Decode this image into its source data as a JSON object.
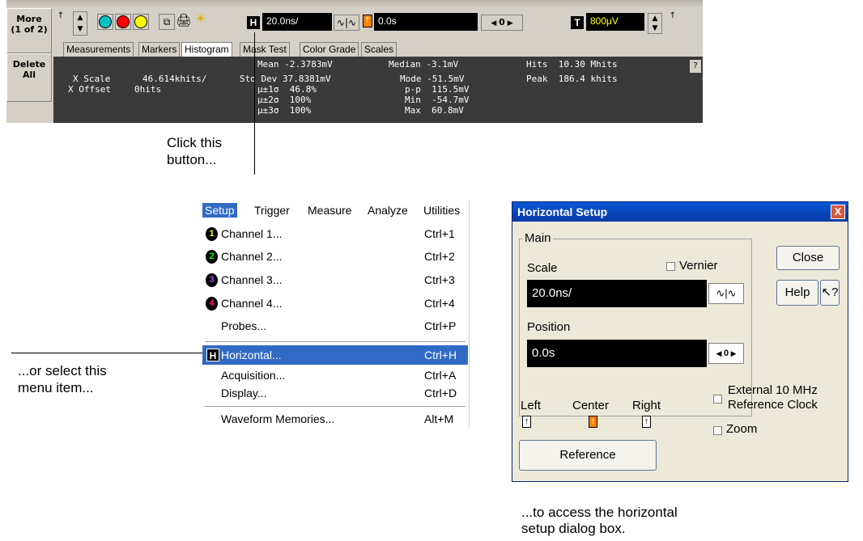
{
  "toolbar": {
    "more_label": "More",
    "more_sub": "(1 of 2)",
    "delete_label": "Delete",
    "delete_sub": "All",
    "h_badge": "H",
    "scale_value": "20.0ns/",
    "position_value": "0.0s",
    "zero_label": "0",
    "trigger_badge": "T",
    "trigger_level": "800μV",
    "tabs": [
      "Measurements",
      "Markers",
      "Histogram",
      "Mask Test",
      "Color Grade",
      "Scales"
    ],
    "stats_left": {
      "x_scale_label": "X Scale",
      "x_scale_value": "46.614khits/",
      "x_offset_label": "X Offset",
      "x_offset_value": "0hits"
    },
    "stats_col1": [
      "Mean -2.3783mV",
      "Std Dev 37.8381mV",
      "μ±1σ  46.8%",
      "μ±2σ  100%",
      "μ±3σ  100%"
    ],
    "stats_col2": [
      "Median -3.1mV",
      "Mode -51.5mV",
      "p-p  115.5mV",
      "Min  -54.7mV",
      "Max  60.8mV"
    ],
    "stats_col3": [
      "Hits  10.30 Mhits",
      "Peak  186.4 khits"
    ],
    "help_q": "?"
  },
  "callouts": {
    "click_button_line1": "Click this",
    "click_button_line2": "button...",
    "select_menu_line1": "...or select this",
    "select_menu_line2": "menu item...",
    "access_line1": "...to access the horizontal",
    "access_line2": "setup dialog box."
  },
  "menu": {
    "bar": [
      "Setup",
      "Trigger",
      "Measure",
      "Analyze",
      "Utilities"
    ],
    "items": [
      {
        "num": "1",
        "label": "Channel 1...",
        "shortcut": "Ctrl+1",
        "color": "#ffff00"
      },
      {
        "num": "2",
        "label": "Channel 2...",
        "shortcut": "Ctrl+2",
        "color": "#00ff00"
      },
      {
        "num": "3",
        "label": "Channel 3...",
        "shortcut": "Ctrl+3",
        "color": "#c040ff"
      },
      {
        "num": "4",
        "label": "Channel 4...",
        "shortcut": "Ctrl+4",
        "color": "#ff2080"
      },
      {
        "label": "Probes...",
        "shortcut": "Ctrl+P"
      },
      {
        "badge": "H",
        "label": "Horizontal...",
        "shortcut": "Ctrl+H"
      },
      {
        "label": "Acquisition...",
        "shortcut": "Ctrl+A"
      },
      {
        "label": "Display...",
        "shortcut": "Ctrl+D"
      },
      {
        "label": "Waveform Memories...",
        "shortcut": "Alt+M"
      }
    ]
  },
  "dialog": {
    "title": "Horizontal Setup",
    "close_x": "X",
    "main_group": "Main",
    "scale_label": "Scale",
    "vernier_label": "Vernier",
    "scale_value": "20.0ns/",
    "position_label": "Position",
    "position_value": "0.0s",
    "zero_label": "0",
    "close_button": "Close",
    "help_button": "Help",
    "whats_this": "?",
    "external_ref_line1": "External 10 MHz",
    "external_ref_line2": "Reference Clock",
    "zoom_label": "Zoom",
    "ref_left": "Left",
    "ref_center": "Center",
    "ref_right": "Right",
    "reference_button": "Reference"
  }
}
